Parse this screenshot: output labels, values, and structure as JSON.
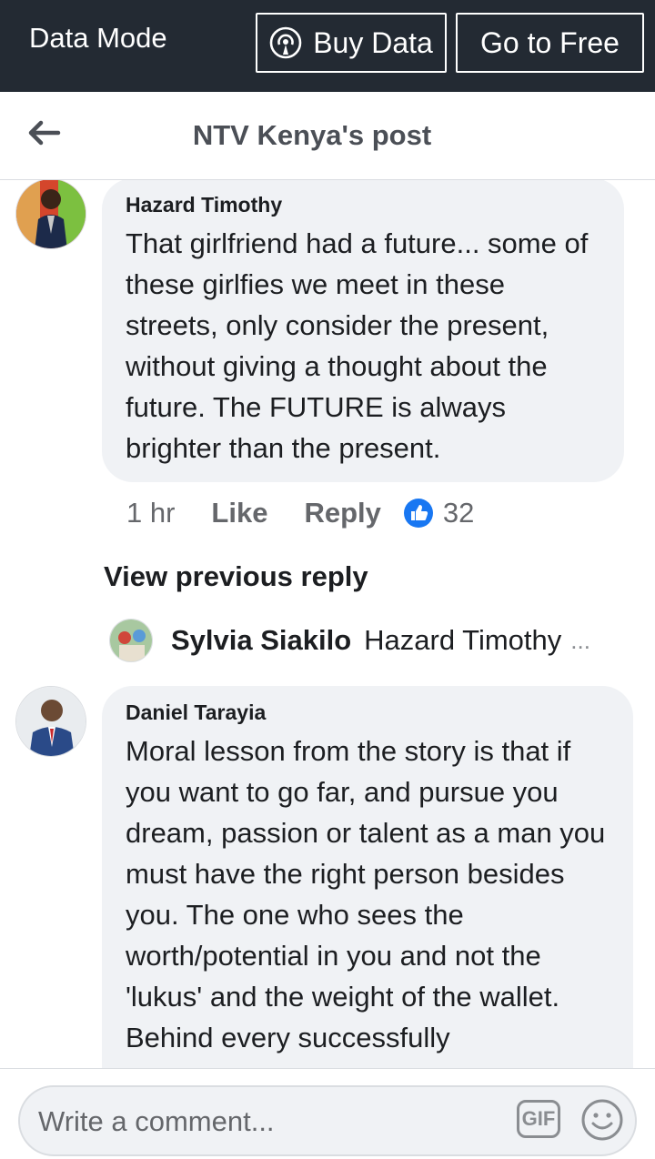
{
  "data_bar": {
    "mode_label": "Data Mode",
    "buy_data_label": "Buy Data",
    "go_free_label": "Go to Free"
  },
  "header": {
    "title": "NTV Kenya's post"
  },
  "comments": [
    {
      "author": "Hazard Timothy",
      "text": "That girlfriend had a future... some of these girlfies we meet in these streets, only consider the present, without giving a thought about the future. The FUTURE is always brighter than the present.",
      "time": "1 hr",
      "like_label": "Like",
      "reply_label": "Reply",
      "reactions": "32"
    },
    {
      "author": "Daniel Tarayia",
      "text": "Moral lesson from the story is that if you want to go far, and pursue you dream, passion or talent as a man you must have the right person besides you. The one who sees the worth/potential in you and not the 'lukus' and the weight of the wallet. Behind every successfully"
    }
  ],
  "view_previous_reply": "View previous reply",
  "reply_preview": {
    "author": "Sylvia Siakilo",
    "text": "Hazard Timothy",
    "ellipsis": "..."
  },
  "composer": {
    "placeholder": "Write a comment...",
    "gif_label": "GIF"
  },
  "colors": {
    "data_bar": "#232a33",
    "bubble": "#f0f2f5",
    "like_blue": "#1877f2",
    "meta_gray": "#65676b"
  }
}
